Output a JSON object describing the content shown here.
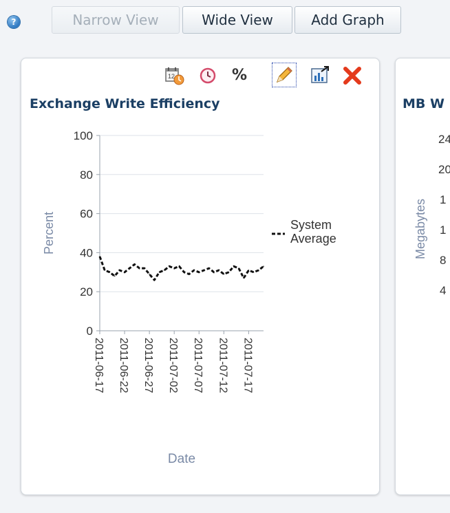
{
  "toolbar": {
    "help_glyph": "?",
    "narrow_view_label": "Narrow View",
    "wide_view_label": "Wide View",
    "add_graph_label": "Add Graph"
  },
  "panel_1": {
    "title": "Exchange Write Efficiency",
    "icons": [
      "calendar-clock-icon",
      "clock-icon",
      "percent-icon",
      "pencil-edit-icon",
      "maximize-chart-icon",
      "close-x-icon"
    ],
    "percent_glyph": "%"
  },
  "panel_2": {
    "title": "MB W",
    "ylabel": "Megabytes",
    "visible_tick_fragments": [
      "24",
      "20",
      "1",
      "1",
      "8",
      "4"
    ]
  },
  "colors": {
    "title": "#1b3f64",
    "axis_label": "#7a8aa6",
    "close_x": "#e43a1c",
    "help": "#2f79c2"
  },
  "chart_data": {
    "type": "line",
    "xlabel": "Date",
    "ylabel": "Percent",
    "ylim": [
      0,
      100
    ],
    "yticks": [
      0,
      20,
      40,
      60,
      80,
      100
    ],
    "xtick_labels": [
      "2011-06-17",
      "2011-06-22",
      "2011-06-27",
      "2011-07-02",
      "2011-07-07",
      "2011-07-12",
      "2011-07-17"
    ],
    "xlim": [
      "2011-06-17",
      "2011-07-20"
    ],
    "grid": true,
    "legend_position": "right",
    "series": [
      {
        "name": "System Average",
        "style": "dashed",
        "color": "#111111",
        "x": [
          "2011-06-17",
          "2011-06-18",
          "2011-06-19",
          "2011-06-20",
          "2011-06-21",
          "2011-06-22",
          "2011-06-23",
          "2011-06-24",
          "2011-06-25",
          "2011-06-26",
          "2011-06-27",
          "2011-06-28",
          "2011-06-29",
          "2011-06-30",
          "2011-07-01",
          "2011-07-02",
          "2011-07-03",
          "2011-07-04",
          "2011-07-05",
          "2011-07-06",
          "2011-07-07",
          "2011-07-08",
          "2011-07-09",
          "2011-07-10",
          "2011-07-11",
          "2011-07-12",
          "2011-07-13",
          "2011-07-14",
          "2011-07-15",
          "2011-07-16",
          "2011-07-17",
          "2011-07-18",
          "2011-07-19",
          "2011-07-20"
        ],
        "y": [
          38,
          31,
          30,
          28,
          31,
          30,
          32,
          34,
          32,
          32,
          29,
          26,
          30,
          31,
          33,
          32,
          33,
          30,
          29,
          31,
          30,
          31,
          32,
          30,
          31,
          29,
          30,
          33,
          32,
          27,
          31,
          30,
          31,
          33
        ]
      }
    ]
  }
}
